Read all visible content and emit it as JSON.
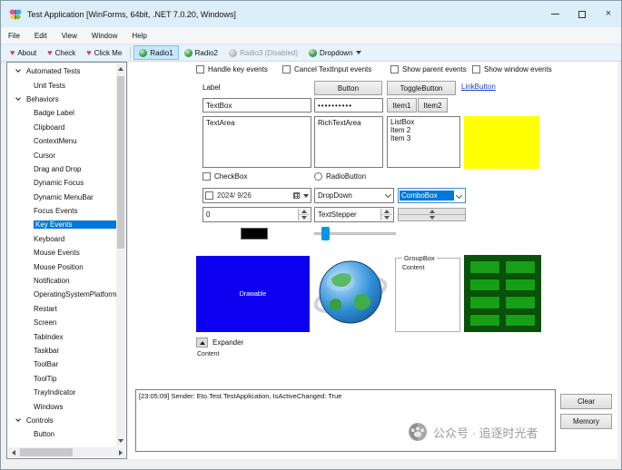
{
  "window": {
    "title": "Test Application [WinForms, 64bit, .NET 7.0.20, Windows]"
  },
  "menu": {
    "items": [
      "File",
      "Edit",
      "View",
      "Window",
      "Help"
    ]
  },
  "toolbar": {
    "about": "About",
    "check": "Check",
    "click_me": "Click Me",
    "radio1": "Radio1",
    "radio2": "Radio2",
    "radio3": "Radio3 (Disabled)",
    "dropdown": "Dropdown"
  },
  "sidebar": {
    "items": [
      {
        "label": "Automated Tests"
      },
      {
        "label": "Unit Tests"
      },
      {
        "label": "Behaviors"
      },
      {
        "label": "Badge Label"
      },
      {
        "label": "Clipboard"
      },
      {
        "label": "ContextMenu"
      },
      {
        "label": "Cursor"
      },
      {
        "label": "Drag and Drop"
      },
      {
        "label": "Dynamic Focus"
      },
      {
        "label": "Dynamic MenuBar"
      },
      {
        "label": "Focus Events"
      },
      {
        "label": "Key Events",
        "selected": true
      },
      {
        "label": "Keyboard"
      },
      {
        "label": "Mouse Events"
      },
      {
        "label": "Mouse Position"
      },
      {
        "label": "Notification"
      },
      {
        "label": "OperatingSystemPlatform"
      },
      {
        "label": "Restart"
      },
      {
        "label": "Screen"
      },
      {
        "label": "TabIndex"
      },
      {
        "label": "Taskbar"
      },
      {
        "label": "ToolBar"
      },
      {
        "label": "ToolTip"
      },
      {
        "label": "TrayIndicator"
      },
      {
        "label": "Windows"
      },
      {
        "label": "Controls"
      },
      {
        "label": "Button"
      }
    ]
  },
  "main": {
    "event_checkboxes": [
      "Handle key events",
      "Cancel TextInput events",
      "Show parent events",
      "Show window events"
    ],
    "label": "Label",
    "button": "Button",
    "toggle_button": "ToggleButton",
    "link_button": "LinkButton",
    "textbox": "TextBox",
    "password": "••••••••••",
    "segmented": [
      "Item1",
      "Item2"
    ],
    "textarea": "TextArea",
    "rich_textarea": "RichTextArea",
    "listbox": [
      "ListBox",
      "Item 2",
      "Item 3"
    ],
    "checkbox": "CheckBox",
    "radiobutton": "RadioButton",
    "date": "2024/ 9/26",
    "dropdown": "DropDown",
    "combobox": "ComboBox",
    "numeric": "0",
    "text_stepper": "TextStepper",
    "drawable": "Drawable",
    "groupbox_title": "GroupBox",
    "groupbox_content": "Content",
    "expander": "Expander",
    "expander_content": "Content",
    "log": "[23:05:09] Sender: Eto.Test.TestApplication, IsActiveChanged: True",
    "clear": "Clear",
    "memory": "Memory"
  },
  "watermark": "公众号 · 追逐时光者",
  "colors": {
    "accent": "#0078d7",
    "yellow_panel": "#ffff00",
    "drawable_blue": "#0d00f0",
    "table_bg": "#0a520a",
    "table_cell": "#17a017"
  }
}
